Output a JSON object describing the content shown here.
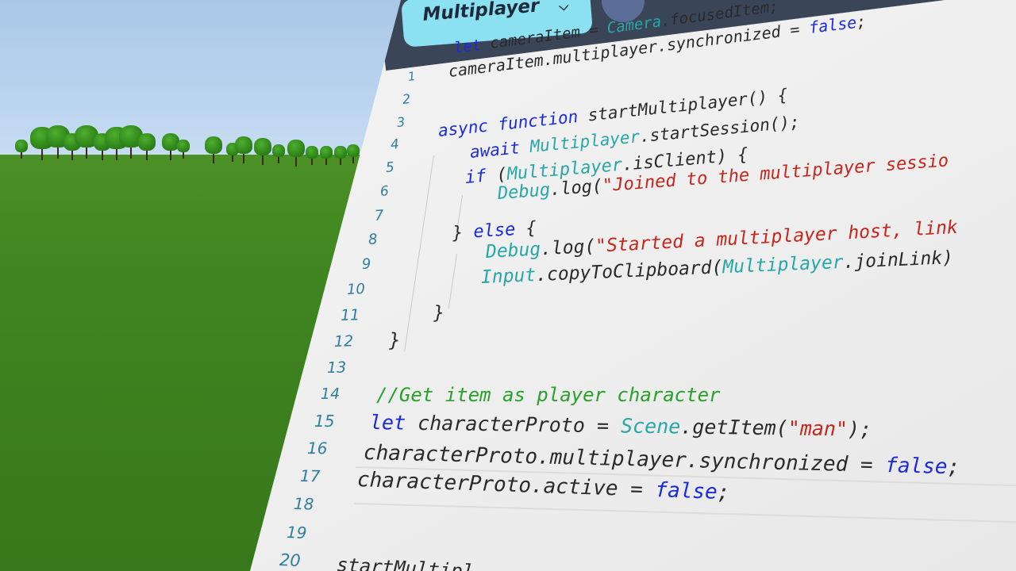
{
  "editor": {
    "tab_label": "Multiplayer",
    "tab_chevron": "chevron-down-icon",
    "line_numbers": [
      "1",
      "2",
      "3",
      "4",
      "5",
      "6",
      "7",
      "8",
      "9",
      "10",
      "11",
      "12",
      "13",
      "14",
      "15",
      "16",
      "17",
      "18",
      "19",
      "20"
    ],
    "code": {
      "l1": [
        "let",
        " cameraItem = ",
        "Camera",
        ".focusedItem;"
      ],
      "l2": [
        "cameraItem.multiplayer.synchronized = ",
        "false",
        ";"
      ],
      "l4": [
        "async",
        " ",
        "function",
        " startMultiplayer() {"
      ],
      "l5": [
        "await",
        " ",
        "Multiplayer",
        ".startSession();"
      ],
      "l6": [
        "if",
        " (",
        "Multiplayer",
        ".isClient) {"
      ],
      "l7": [
        "Debug",
        ".log(",
        "\"Joined to the multiplayer sessio"
      ],
      "l8": [
        "} ",
        "else",
        " {"
      ],
      "l9": [
        "Debug",
        ".log(",
        "\"Started a multiplayer host, link"
      ],
      "l10": [
        "Input",
        ".copyToClipboard(",
        "Multiplayer",
        ".joinLink)"
      ],
      "l11": [
        "}"
      ],
      "l12": [
        "}"
      ],
      "l14": [
        "//Get item as player character"
      ],
      "l15": [
        "let",
        " characterProto = ",
        "Scene",
        ".getItem(",
        "\"man\"",
        ");"
      ],
      "l16": [
        "characterProto.multiplayer.synchronized = ",
        "false",
        ";"
      ],
      "l17": [
        "characterProto.active = ",
        "false",
        ";"
      ],
      "l20": [
        "startMultipl"
      ]
    }
  },
  "colors": {
    "keyword": "#1a2ae0",
    "class": "#26a7a8",
    "string": "#c8251b",
    "comment": "#2aa12a",
    "identifier": "#2a2a2a",
    "tab_bg": "#8be0f2",
    "topbar_bg": "#3b4558"
  }
}
